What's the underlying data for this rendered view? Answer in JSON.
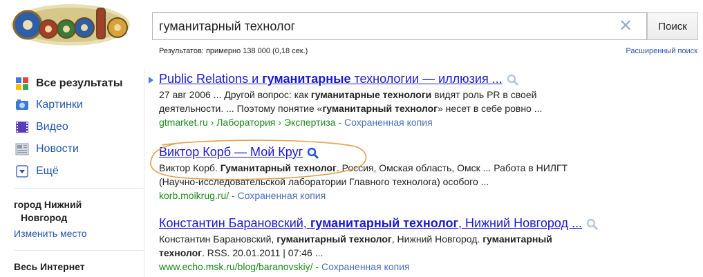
{
  "search": {
    "query": "гуманитарный технолог",
    "button_label": "Поиск",
    "stats": "Результатов: примерно 138 000 (0,18 сек.)",
    "advanced": "Расширенный поиск"
  },
  "leftnav": {
    "items": [
      {
        "label": "Все результаты",
        "icon": "all-results-icon"
      },
      {
        "label": "Картинки",
        "icon": "images-icon"
      },
      {
        "label": "Видео",
        "icon": "video-icon"
      },
      {
        "label": "Новости",
        "icon": "news-icon"
      },
      {
        "label": "Ещё",
        "icon": "more-icon"
      }
    ],
    "location_line1": "город Нижний",
    "location_line2": "Новгород",
    "change_place": "Изменить место",
    "web_scope": "Весь Интернет"
  },
  "results": [
    {
      "title_a": "Public Relations и ",
      "title_b": "гуманитарные",
      "title_c": " технологии — иллюзия ...",
      "s1a": "27 авг 2006 ... Другой вопрос: как ",
      "s1b": "гуманитарные технологи",
      "s1c": " видят роль PR в своей",
      "s2a": "деятельности. ... Поэтому понятие «",
      "s2b": "гуманитарный технолог",
      "s2c": "» несет в себе ровно ...",
      "url": "gtmarket.ru › Лаборатория › Экспертиза",
      "cache": "Сохраненная копия"
    },
    {
      "title": "Виктор Корб — Мой Круг",
      "s1a": "Виктор Корб. ",
      "s1b": "Гуманитарный технолог",
      "s1c": ". Россия, Омская область, Омск ... Работа в НИЛГТ",
      "s2": "(Научно-исследовательской лаборатории Главного технолога) особого ...",
      "url": "korb.moikrug.ru/",
      "cache": "Сохраненная копия"
    },
    {
      "title_a": "Константин Барановский, ",
      "title_b": "гуманитарный технолог",
      "title_c": ", Нижний Новгород ...",
      "s1a": "Константин Барановский, ",
      "s1b": "гуманитарный технолог",
      "s1c": ", Нижний Новгород. ",
      "s1d": "гуманитарный",
      "s2a": "технолог",
      "s2b": ". RSS. 20.01.2011 | 07:46 ...",
      "url": "www.echo.msk.ru/blog/baranovskiy/",
      "cache": "Сохраненная копия"
    }
  ],
  "colors": {
    "link": "#1a1ad0",
    "url_green": "#1a8a1a",
    "nav_blue": "#2255aa",
    "annotation": "#e0a050"
  }
}
